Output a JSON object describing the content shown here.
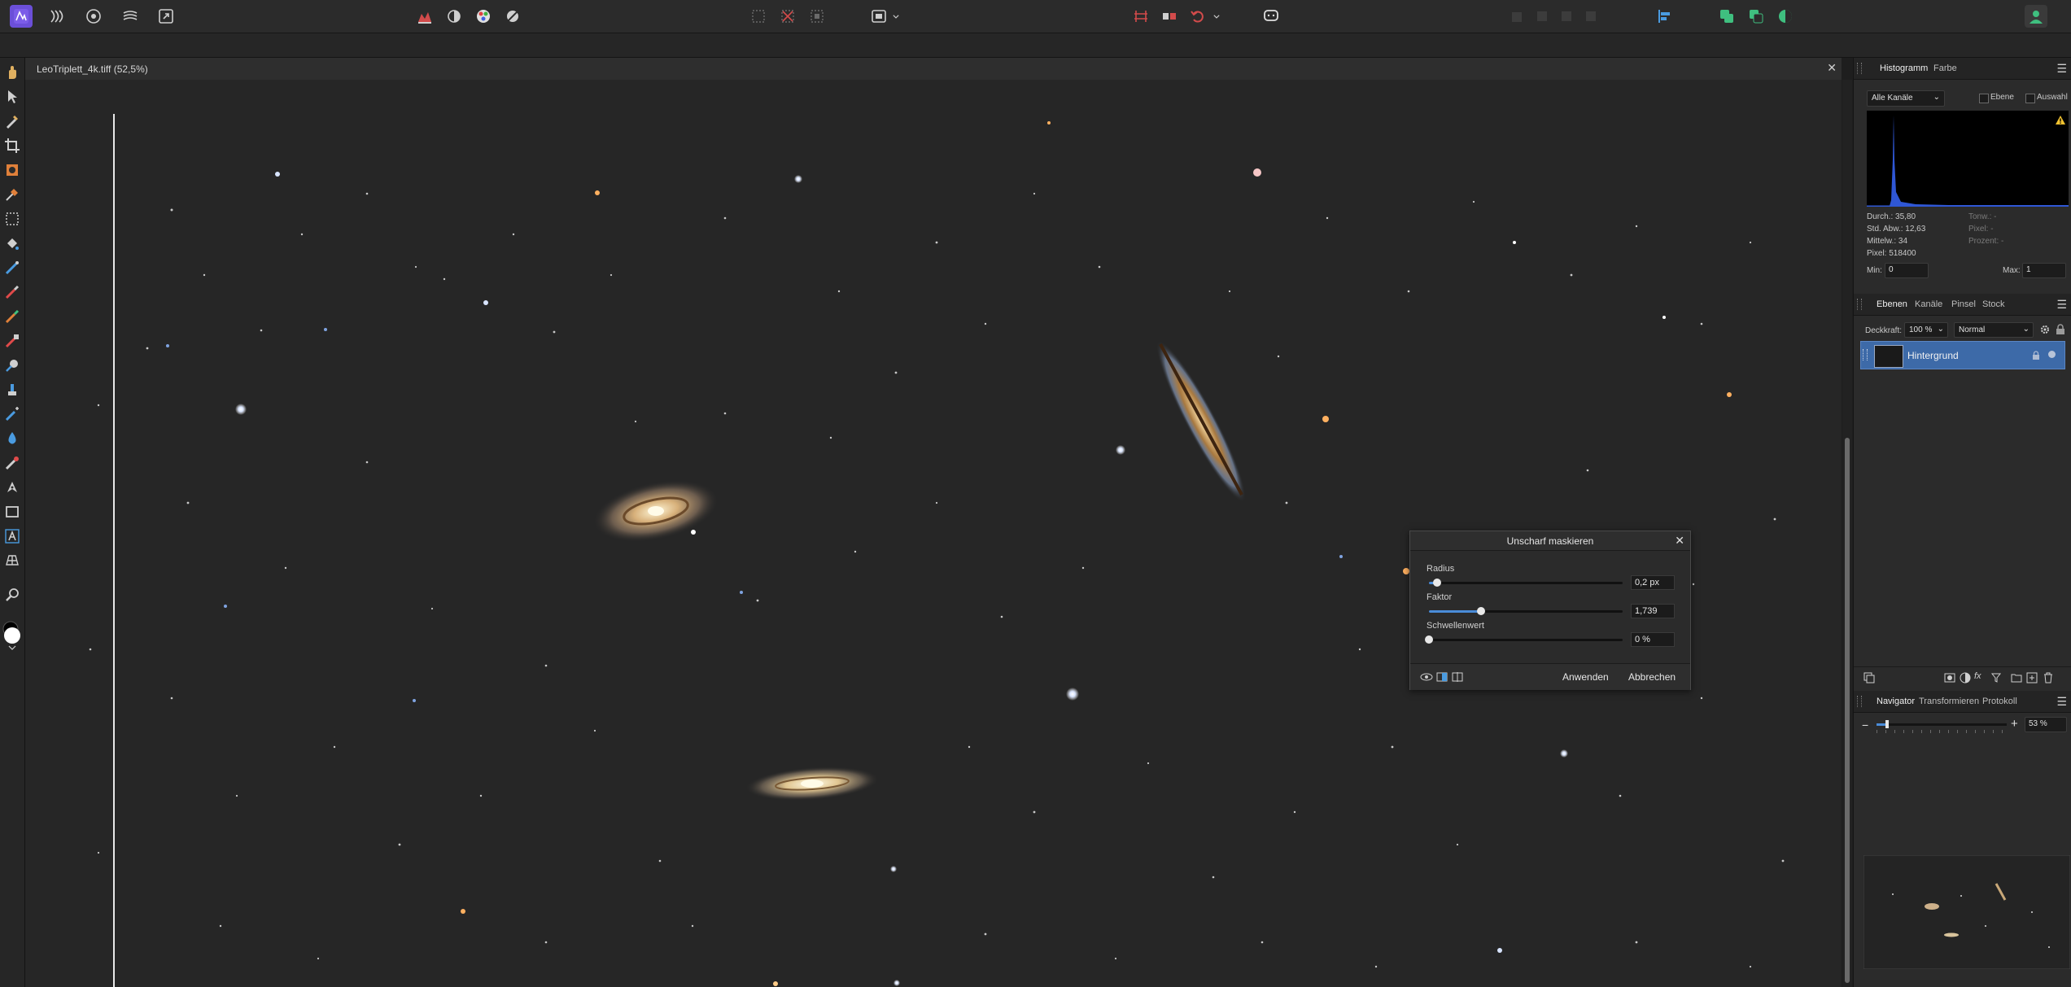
{
  "app": {
    "name": "Affinity Photo",
    "accent": "#6b4fd8"
  },
  "document": {
    "title": "LeoTriplett_4k.tiff (52,5%)"
  },
  "toolbar": {
    "personas": [
      "photo-persona-icon",
      "liquify-persona-icon",
      "develop-persona-icon",
      "tone-mapping-persona-icon",
      "export-persona-icon"
    ]
  },
  "histogram": {
    "tabs": [
      "Histogramm",
      "Farbe"
    ],
    "channel": "Alle Kanäle",
    "layer_label": "Ebene",
    "selection_label": "Auswahl",
    "stats_left": [
      "Durch.: 35,80",
      "Std. Abw.: 12,63",
      "Mittelw.: 34",
      "Pixel: 518400"
    ],
    "stats_right": [
      "Tonw.: -",
      "Pixel: -",
      "Prozent: -"
    ],
    "min_label": "Min:",
    "min_value": "0",
    "max_label": "Max:",
    "max_value": "1",
    "warning_icon": "warning-icon",
    "curve_color": "#2f57d6"
  },
  "layers": {
    "tabs": [
      "Ebenen",
      "Kanäle",
      "Pinsel",
      "Stock"
    ],
    "opacity_label": "Deckkraft:",
    "opacity_value": "100 %",
    "blend_mode": "Normal",
    "items": [
      {
        "name": "Hintergrund",
        "selected": true,
        "locked": true
      }
    ],
    "selected_color": "#3d6aa8"
  },
  "navigator": {
    "tabs": [
      "Navigator",
      "Transformieren",
      "Protokoll"
    ],
    "zoom_value": "53 %",
    "zoom_minus": "−",
    "zoom_plus": "+",
    "zoom_fraction": 0.08
  },
  "dialog": {
    "title": "Unscharf maskieren",
    "sliders": [
      {
        "label": "Radius",
        "value": "0,2 px",
        "fraction": 0.04
      },
      {
        "label": "Faktor",
        "value": "1,739",
        "fraction": 0.27
      },
      {
        "label": "Schwellenwert",
        "value": "0 %",
        "fraction": 0.0
      }
    ],
    "apply": "Anwenden",
    "cancel": "Abbrechen"
  }
}
